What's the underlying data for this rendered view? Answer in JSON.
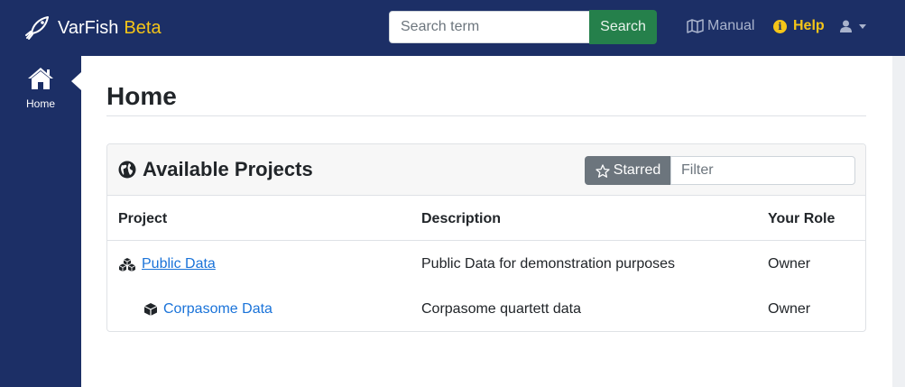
{
  "navbar": {
    "brand_name": "VarFish",
    "brand_badge": "Beta",
    "search": {
      "placeholder": "Search term",
      "value": "",
      "button_label": "Search"
    },
    "manual_label": "Manual",
    "help_label": "Help",
    "user_menu_icon": "user-icon"
  },
  "sidebar": {
    "items": [
      {
        "label": "Home",
        "icon": "home-icon",
        "active": true
      }
    ]
  },
  "main": {
    "title": "Home",
    "projects_card": {
      "title": "Available Projects",
      "starred_label": "Starred",
      "filter_placeholder": "Filter",
      "columns": [
        "Project",
        "Description",
        "Your Role"
      ],
      "rows": [
        {
          "name": "Public Data",
          "description": "Public Data for demonstration purposes",
          "role": "Owner",
          "type": "category",
          "icon": "cubes-icon"
        },
        {
          "name": "Corpasome Data",
          "description": "Corpasome quartett data",
          "role": "Owner",
          "type": "project",
          "icon": "cube-icon"
        }
      ]
    }
  },
  "colors": {
    "navbar_bg": "#1c2f66",
    "search_button": "#25804b",
    "help_accent": "#f5c518",
    "link": "#1a73d9",
    "starred_button": "#6c757d"
  }
}
